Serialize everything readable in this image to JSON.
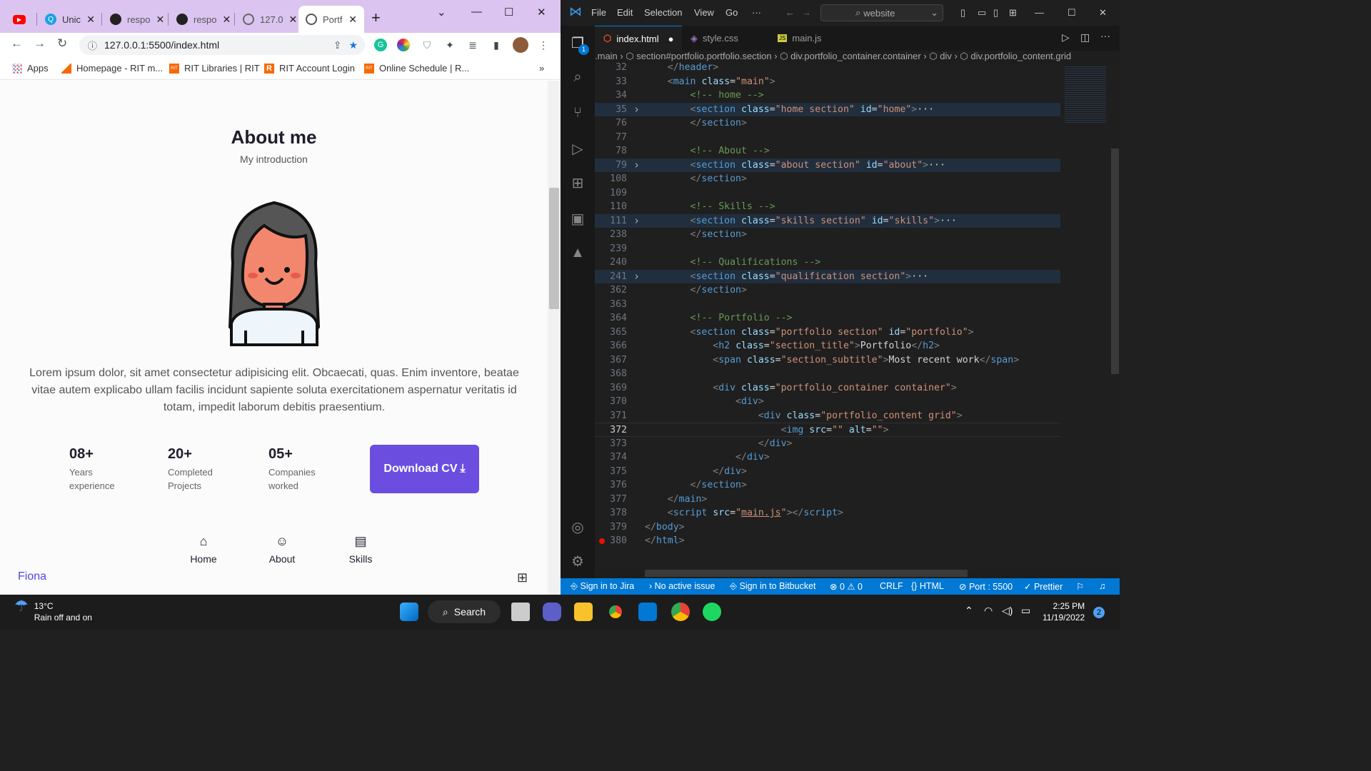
{
  "browser": {
    "tabs": [
      {
        "title": "",
        "icon": "youtube-icon",
        "color": "#ff0000"
      },
      {
        "title": "Unic",
        "icon": "unicode-search-icon",
        "color": "#1ba1e2"
      },
      {
        "title": "respo",
        "icon": "github-icon",
        "color": "#222222"
      },
      {
        "title": "respo",
        "icon": "github-icon",
        "color": "#222222"
      },
      {
        "title": "127.0",
        "icon": "globe-icon",
        "color": "#555555"
      },
      {
        "title": "Portf",
        "icon": "globe-icon",
        "color": "#555555"
      }
    ],
    "url": "127.0.0.1:5500/index.html",
    "bookmarks": [
      {
        "label": "Apps",
        "icon": "apps-grid-icon"
      },
      {
        "label": "Homepage - RIT m...",
        "icon": "rit-icon"
      },
      {
        "label": "RIT Libraries | RIT",
        "icon": "rit-icon"
      },
      {
        "label": "RIT Account Login",
        "icon": "rit-r-icon"
      },
      {
        "label": "Online Schedule | R...",
        "icon": "rit-icon"
      }
    ],
    "more_bookmarks": "»"
  },
  "portfolio": {
    "title": "About me",
    "subtitle": "My introduction",
    "description": "Lorem ipsum dolor, sit amet consectetur adipisicing elit. Obcaecati, quas. Enim inventore, beatae vitae autem explicabo ullam facilis incidunt sapiente soluta exercitationem aspernatur veritatis id totam, impedit laborum debitis praesentium.",
    "stats": [
      {
        "number": "08+",
        "label1": "Years",
        "label2": "experience"
      },
      {
        "number": "20+",
        "label1": "Completed",
        "label2": "Projects"
      },
      {
        "number": "05+",
        "label1": "Companies",
        "label2": "worked"
      }
    ],
    "cv_button": "Download CV",
    "nav": [
      {
        "label": "Home",
        "icon": "home-icon"
      },
      {
        "label": "About",
        "icon": "user-icon"
      },
      {
        "label": "Skills",
        "icon": "document-icon"
      }
    ],
    "brand": "Fiona",
    "accent": "#6b4ee0"
  },
  "vscode": {
    "menu": [
      "File",
      "Edit",
      "Selection",
      "View",
      "Go",
      "···"
    ],
    "search": "website",
    "tabs": [
      {
        "label": "index.html",
        "icon": "html-icon",
        "modified": true
      },
      {
        "label": "style.css",
        "icon": "css-icon"
      },
      {
        "label": "main.js",
        "icon": "js-icon"
      }
    ],
    "explorer_badge": "1",
    "breadcrumbs": ".main  ›  ⬡ section#portfolio.portfolio.section  ›  ⬡ div.portfolio_container.container  ›  ⬡ div  ›  ⬡ div.portfolio_content.grid",
    "lines": [
      {
        "n": "32",
        "html": "<span class='p'>    &lt;/</span><span class='t'>header</span><span class='p'>&gt;</span>"
      },
      {
        "n": "33",
        "html": "    <span class='p'>&lt;</span><span class='t'>main</span> <span class='a'>class</span><span class='w'>=</span><span class='s'>\"main\"</span><span class='p'>&gt;</span>"
      },
      {
        "n": "34",
        "html": "        <span class='c'>&lt;!-- home --&gt;</span>"
      },
      {
        "n": "35",
        "fold": true,
        "hl": true,
        "html": "        <span class='p'>&lt;</span><span class='t'>section</span> <span class='a'>class</span><span class='w'>=</span><span class='s'>\"home section\"</span> <span class='a'>id</span><span class='w'>=</span><span class='s'>\"home\"</span><span class='p'>&gt;</span><span class='w'>···</span>"
      },
      {
        "n": "76",
        "html": "        <span class='p'>&lt;/</span><span class='t'>section</span><span class='p'>&gt;</span>"
      },
      {
        "n": "77",
        "html": ""
      },
      {
        "n": "78",
        "html": "        <span class='c'>&lt;!-- About --&gt;</span>"
      },
      {
        "n": "79",
        "fold": true,
        "hl": true,
        "html": "        <span class='p'>&lt;</span><span class='t'>section</span> <span class='a'>class</span><span class='w'>=</span><span class='s'>\"about section\"</span> <span class='a'>id</span><span class='w'>=</span><span class='s'>\"about\"</span><span class='p'>&gt;</span><span class='w'>···</span>"
      },
      {
        "n": "108",
        "html": "        <span class='p'>&lt;/</span><span class='t'>section</span><span class='p'>&gt;</span>"
      },
      {
        "n": "109",
        "html": ""
      },
      {
        "n": "110",
        "html": "        <span class='c'>&lt;!-- Skills --&gt;</span>"
      },
      {
        "n": "111",
        "fold": true,
        "hl": true,
        "html": "        <span class='p'>&lt;</span><span class='t'>section</span> <span class='a'>class</span><span class='w'>=</span><span class='s'>\"skills section\"</span> <span class='a'>id</span><span class='w'>=</span><span class='s'>\"skills\"</span><span class='p'>&gt;</span><span class='w'>···</span>"
      },
      {
        "n": "238",
        "html": "        <span class='p'>&lt;/</span><span class='t'>section</span><span class='p'>&gt;</span>"
      },
      {
        "n": "239",
        "html": ""
      },
      {
        "n": "240",
        "html": "        <span class='c'>&lt;!-- Qualifications --&gt;</span>"
      },
      {
        "n": "241",
        "fold": true,
        "hl": true,
        "html": "        <span class='p'>&lt;</span><span class='t'>section</span> <span class='a'>class</span><span class='w'>=</span><span class='s'>\"qualification section\"</span><span class='p'>&gt;</span><span class='w'>···</span>"
      },
      {
        "n": "362",
        "html": "        <span class='p'>&lt;/</span><span class='t'>section</span><span class='p'>&gt;</span>"
      },
      {
        "n": "363",
        "html": ""
      },
      {
        "n": "364",
        "html": "        <span class='c'>&lt;!-- Portfolio --&gt;</span>"
      },
      {
        "n": "365",
        "html": "        <span class='p'>&lt;</span><span class='t'>section</span> <span class='a'>class</span><span class='w'>=</span><span class='s'>\"portfolio section\"</span> <span class='a'>id</span><span class='w'>=</span><span class='s'>\"portfolio\"</span><span class='p'>&gt;</span>"
      },
      {
        "n": "366",
        "html": "            <span class='p'>&lt;</span><span class='t'>h2</span> <span class='a'>class</span><span class='w'>=</span><span class='s'>\"section_title\"</span><span class='p'>&gt;</span><span class='w'>Portfolio</span><span class='p'>&lt;/</span><span class='t'>h2</span><span class='p'>&gt;</span>"
      },
      {
        "n": "367",
        "html": "            <span class='p'>&lt;</span><span class='t'>span</span> <span class='a'>class</span><span class='w'>=</span><span class='s'>\"section_subtitle\"</span><span class='p'>&gt;</span><span class='w'>Most recent work</span><span class='p'>&lt;/</span><span class='t'>span</span><span class='p'>&gt;</span>"
      },
      {
        "n": "368",
        "html": ""
      },
      {
        "n": "369",
        "html": "            <span class='p'>&lt;</span><span class='t'>div</span> <span class='a'>class</span><span class='w'>=</span><span class='s'>\"portfolio_container container\"</span><span class='p'>&gt;</span>"
      },
      {
        "n": "370",
        "html": "                <span class='p'>&lt;</span><span class='t'>div</span><span class='p'>&gt;</span>"
      },
      {
        "n": "371",
        "html": "                    <span class='p'>&lt;</span><span class='t'>div</span> <span class='a'>class</span><span class='w'>=</span><span class='s'>\"portfolio_content grid\"</span><span class='p'>&gt;</span>"
      },
      {
        "n": "372",
        "cur": true,
        "html": "                        <span class='p'>&lt;</span><span class='t'>img</span> <span class='a'>src</span><span class='w'>=</span><span class='s'>\"\"</span> <span class='a'>alt</span><span class='w'>=</span><span class='s'>\"\"</span><span class='p'>&gt;</span>"
      },
      {
        "n": "373",
        "html": "                    <span class='p'>&lt;/</span><span class='t'>div</span><span class='p'>&gt;</span>"
      },
      {
        "n": "374",
        "html": "                <span class='p'>&lt;/</span><span class='t'>div</span><span class='p'>&gt;</span>"
      },
      {
        "n": "375",
        "html": "            <span class='p'>&lt;/</span><span class='t'>div</span><span class='p'>&gt;</span>"
      },
      {
        "n": "376",
        "html": "        <span class='p'>&lt;/</span><span class='t'>section</span><span class='p'>&gt;</span>"
      },
      {
        "n": "377",
        "html": "    <span class='p'>&lt;/</span><span class='t'>main</span><span class='p'>&gt;</span>"
      },
      {
        "n": "378",
        "html": "    <span class='p'>&lt;</span><span class='t'>script</span> <span class='a'>src</span><span class='w'>=</span><span class='s'>\"<u>main.js</u>\"</span><span class='p'>&gt;&lt;/</span><span class='t'>script</span><span class='p'>&gt;</span>"
      },
      {
        "n": "379",
        "html": "<span class='p'>&lt;/</span><span class='t'>body</span><span class='p'>&gt;</span>"
      },
      {
        "n": "380",
        "bp": true,
        "html": "<span class='p'>&lt;/</span><span class='t'>html</span><span class='p'>&gt;</span>"
      }
    ],
    "status": {
      "jira": "Sign in to Jira",
      "issue": "No active issue",
      "bitbucket": "Sign in to Bitbucket",
      "problems": "⊗ 0 ⚠ 0",
      "eol": "CRLF",
      "lang": "{} HTML",
      "port": "Port : 5500",
      "prettier": "✓ Prettier"
    }
  },
  "taskbar": {
    "temp": "13°C",
    "weather": "Rain off and on",
    "search": "Search",
    "time": "2:25 PM",
    "date": "11/19/2022",
    "notifications": "2"
  }
}
